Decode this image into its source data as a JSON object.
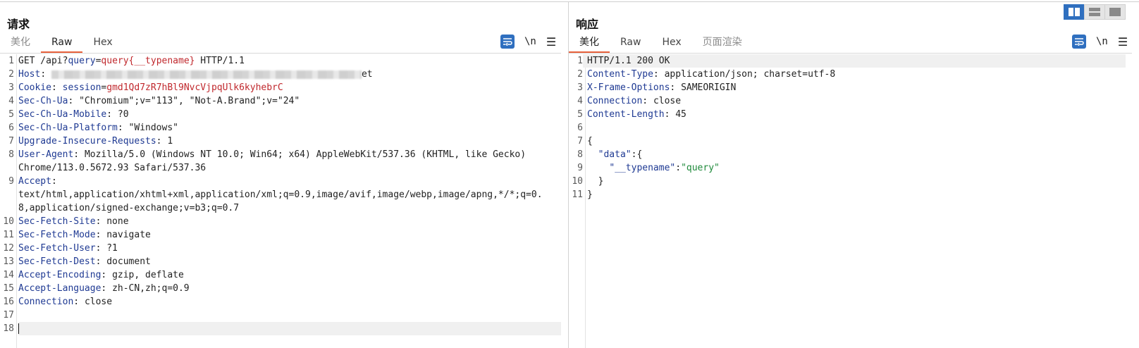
{
  "request": {
    "title": "请求",
    "tabs": [
      "美化",
      "Raw",
      "Hex"
    ],
    "active_tab": "Raw",
    "tools": {
      "newline_label": "\\n",
      "menu_label": "☰"
    },
    "lines": {
      "l1": {
        "n": "1",
        "method": "GET /api?",
        "param": "query",
        "eq": "=",
        "value": "query{__typename}",
        "proto": " HTTP/1.1"
      },
      "l2": {
        "n": "2",
        "key": "Host",
        "sep": ": ",
        "tail": "et"
      },
      "l3": {
        "n": "3",
        "key": "Cookie",
        "sep": ": ",
        "ckey": "session",
        "ceq": "=",
        "cval": "gmd1Qd7zR7hBl9NvcVjpqUlk6kyhebrC"
      },
      "l4": {
        "n": "4",
        "key": "Sec-Ch-Ua",
        "sep": ": ",
        "val": "\"Chromium\";v=\"113\", \"Not-A.Brand\";v=\"24\""
      },
      "l5": {
        "n": "5",
        "key": "Sec-Ch-Ua-Mobile",
        "sep": ": ",
        "val": "?0"
      },
      "l6": {
        "n": "6",
        "key": "Sec-Ch-Ua-Platform",
        "sep": ": ",
        "val": "\"Windows\""
      },
      "l7": {
        "n": "7",
        "key": "Upgrade-Insecure-Requests",
        "sep": ": ",
        "val": "1"
      },
      "l8": {
        "n": "8",
        "key": "User-Agent",
        "sep": ": ",
        "val": "Mozilla/5.0 (Windows NT 10.0; Win64; x64) AppleWebKit/537.36 (KHTML, like Gecko)",
        "cont": "Chrome/113.0.5672.93 Safari/537.36"
      },
      "l9": {
        "n": "9",
        "key": "Accept",
        "sep": ":",
        "cont1": "text/html,application/xhtml+xml,application/xml;q=0.9,image/avif,image/webp,image/apng,*/*;q=0.",
        "cont2": "8,application/signed-exchange;v=b3;q=0.7"
      },
      "l10": {
        "n": "10",
        "key": "Sec-Fetch-Site",
        "sep": ": ",
        "val": "none"
      },
      "l11": {
        "n": "11",
        "key": "Sec-Fetch-Mode",
        "sep": ": ",
        "val": "navigate"
      },
      "l12": {
        "n": "12",
        "key": "Sec-Fetch-User",
        "sep": ": ",
        "val": "?1"
      },
      "l13": {
        "n": "13",
        "key": "Sec-Fetch-Dest",
        "sep": ": ",
        "val": "document"
      },
      "l14": {
        "n": "14",
        "key": "Accept-Encoding",
        "sep": ": ",
        "val": "gzip, deflate"
      },
      "l15": {
        "n": "15",
        "key": "Accept-Language",
        "sep": ": ",
        "val": "zh-CN,zh;q=0.9"
      },
      "l16": {
        "n": "16",
        "key": "Connection",
        "sep": ": ",
        "val": "close"
      },
      "l17": {
        "n": "17"
      },
      "l18": {
        "n": "18"
      }
    }
  },
  "response": {
    "title": "响应",
    "tabs": [
      "美化",
      "Raw",
      "Hex",
      "页面渲染"
    ],
    "active_tab": "美化",
    "tools": {
      "newline_label": "\\n",
      "menu_label": "☰"
    },
    "lines": {
      "l1": {
        "n": "1",
        "text": "HTTP/1.1 200 OK"
      },
      "l2": {
        "n": "2",
        "key": "Content-Type",
        "sep": ": ",
        "val": "application/json; charset=utf-8"
      },
      "l3": {
        "n": "3",
        "key": "X-Frame-Options",
        "sep": ": ",
        "val": "SAMEORIGIN"
      },
      "l4": {
        "n": "4",
        "key": "Connection",
        "sep": ": ",
        "val": "close"
      },
      "l5": {
        "n": "5",
        "key": "Content-Length",
        "sep": ": ",
        "val": "45"
      },
      "l6": {
        "n": "6"
      },
      "l7": {
        "n": "7",
        "text": "{"
      },
      "l8": {
        "n": "8",
        "indent": "  ",
        "jkey": "\"data\"",
        "rest": ":{"
      },
      "l9": {
        "n": "9",
        "indent": "    ",
        "jkey": "\"__typename\"",
        "colon": ":",
        "jval": "\"query\""
      },
      "l10": {
        "n": "10",
        "text": "  }"
      },
      "l11": {
        "n": "11",
        "text": "}"
      }
    }
  },
  "colors": {
    "accent": "#2f6fbf",
    "tab_active": "#e8623d",
    "header_key": "#1f3a93",
    "string_red": "#c0282d",
    "string_green": "#1f8a3b"
  }
}
